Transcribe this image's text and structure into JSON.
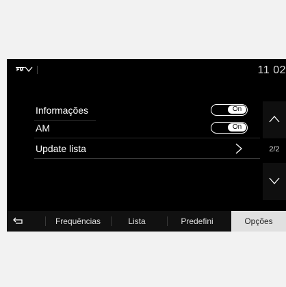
{
  "status_bar": {
    "source_badge": "FM",
    "clock": "11 02"
  },
  "options": [
    {
      "label": "Informações",
      "control": "toggle",
      "state": "On"
    },
    {
      "label": "AM",
      "control": "toggle",
      "state": "On"
    },
    {
      "label": "Update lista",
      "control": "chevron"
    }
  ],
  "pagination": {
    "indicator": "2/2"
  },
  "tabs": [
    {
      "label": "Frequências"
    },
    {
      "label": "Lista"
    },
    {
      "label": "Predefini"
    },
    {
      "label": "Opções",
      "active": true
    }
  ],
  "icons": {
    "back": "back-arrow-icon",
    "source_menu": "chevron-down-icon",
    "scroll_up": "chevron-up-icon",
    "scroll_down": "chevron-down-icon",
    "row_next": "chevron-right-icon"
  },
  "colors": {
    "screen_bg": "#000000",
    "frame_bg": "#f2f2f2",
    "active_tab_bg": "#e0e0e0",
    "text": "#ffffff"
  }
}
